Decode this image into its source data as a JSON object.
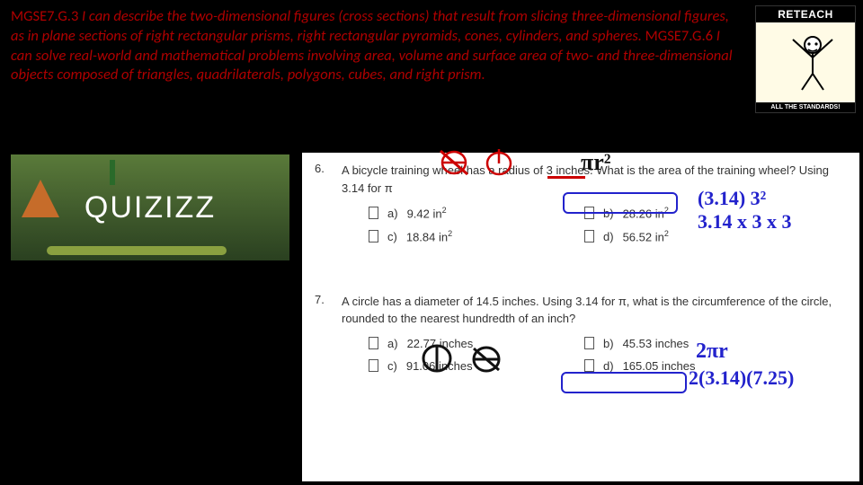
{
  "header": {
    "code1": "MGSE7.G.3 ",
    "text1": "I can describe the two-dimensional figures (cross sections) that result from slicing three-dimensional figures, as in plane sections of right rectangular prisms, right rectangular pyramids, cones, cylinders, and spheres. ",
    "code2": "MGSE7.G.6 ",
    "text2": "I can solve real-world and mathematical problems involving area, volume and surface area of two- and three-dimensional objects composed of triangles, quadrilaterals, polygons, cubes, and right prism."
  },
  "reteach": {
    "top": "RETEACH",
    "bottom": "ALL THE STANDARDS!"
  },
  "quizizz": {
    "logo": "QUIZIZZ"
  },
  "q6": {
    "num": "6.",
    "text": "A bicycle training wheel has a radius of 3 inches. What is the area of the training wheel? Using 3.14 for π",
    "a_lab": "a)",
    "a_val": "9.42 in",
    "a_unit": "2",
    "b_lab": "b)",
    "b_val": "28.26 in",
    "b_unit": "2",
    "c_lab": "c)",
    "c_val": "18.84 in",
    "c_unit": "2",
    "d_lab": "d)",
    "d_val": "56.52 in",
    "d_unit": "2"
  },
  "q7": {
    "num": "7.",
    "text": "A circle has a diameter of 14.5 inches. Using 3.14 for π, what is the circumference of the circle, rounded to the nearest hundredth of an inch?",
    "a_lab": "a)",
    "a_val": "22.77 inches",
    "b_lab": "b)",
    "b_val": "45.53 inches",
    "c_lab": "c)",
    "c_val": "91.06 inches",
    "d_lab": "d)",
    "d_val": "165.05 inches"
  },
  "annot": {
    "pir2": "πr²",
    "calc1": "(3.14) 3²",
    "calc2": "3.14 x 3 x 3",
    "twopir": "2πr",
    "calc3": "2(3.14)(7.25)"
  }
}
